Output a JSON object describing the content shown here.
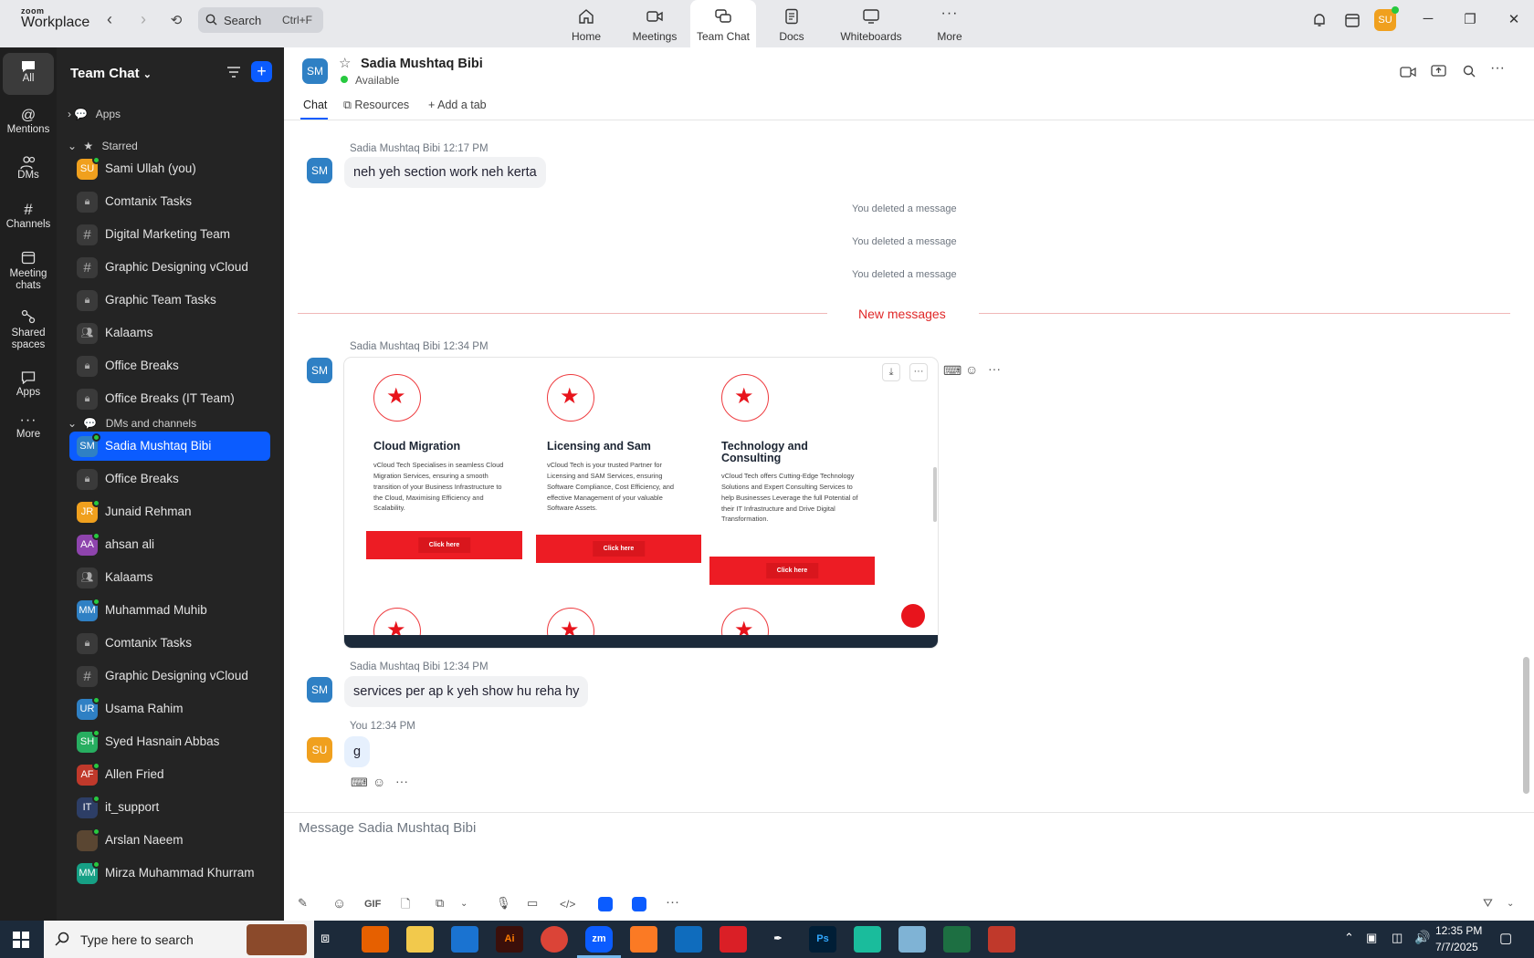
{
  "app": {
    "brand_top": "zoom",
    "brand_bottom": "Workplace"
  },
  "search": {
    "placeholder": "Search",
    "shortcut": "Ctrl+F"
  },
  "topnav": [
    {
      "label": "Home"
    },
    {
      "label": "Meetings"
    },
    {
      "label": "Team Chat"
    },
    {
      "label": "Docs"
    },
    {
      "label": "Whiteboards"
    },
    {
      "label": "More"
    }
  ],
  "user_avatar": "SU",
  "rail": [
    {
      "label": "All"
    },
    {
      "label": "Mentions"
    },
    {
      "label": "DMs"
    },
    {
      "label": "Channels"
    },
    {
      "label": "Meeting chats"
    },
    {
      "label": "Shared spaces"
    },
    {
      "label": "Apps"
    },
    {
      "label": "More"
    }
  ],
  "sidebar": {
    "title": "Team Chat",
    "apps_label": "Apps",
    "starred_label": "Starred",
    "starred": [
      {
        "label": "Sami Ullah (you)",
        "initials": "SU",
        "color": "#f0a01e"
      },
      {
        "label": "Comtanix Tasks",
        "kind": "lock"
      },
      {
        "label": "Digital Marketing Team",
        "kind": "hash"
      },
      {
        "label": "Graphic Designing vCloud",
        "kind": "hash"
      },
      {
        "label": "Graphic Team Tasks",
        "kind": "lock"
      },
      {
        "label": "Kalaams",
        "kind": "group"
      },
      {
        "label": "Office Breaks",
        "kind": "lock"
      },
      {
        "label": "Office Breaks (IT Team)",
        "kind": "lock"
      }
    ],
    "dms_label": "DMs and channels",
    "dms": [
      {
        "label": "Sadia Mushtaq Bibi",
        "initials": "SM",
        "color": "#2f80c4"
      },
      {
        "label": "Office Breaks",
        "kind": "lock"
      },
      {
        "label": "Junaid Rehman",
        "initials": "JR",
        "color": "#f0a01e"
      },
      {
        "label": "ahsan ali",
        "initials": "AA",
        "color": "#8e44ad"
      },
      {
        "label": "Kalaams",
        "kind": "group"
      },
      {
        "label": "Muhammad Muhib",
        "initials": "MM",
        "color": "#2f80c4"
      },
      {
        "label": "Comtanix Tasks",
        "kind": "lock"
      },
      {
        "label": "Graphic Designing vCloud",
        "kind": "hash"
      },
      {
        "label": "Usama Rahim",
        "initials": "UR",
        "color": "#2f80c4"
      },
      {
        "label": "Syed Hasnain Abbas",
        "initials": "SH",
        "color": "#27ae60"
      },
      {
        "label": "Allen Fried",
        "initials": "AF",
        "color": "#c0392b"
      },
      {
        "label": "it_support",
        "initials": "IT",
        "color": "#2d3e66"
      },
      {
        "label": "Arslan Naeem",
        "initials": "",
        "color": "#5a4632"
      },
      {
        "label": "Mirza Muhammad Khurram",
        "initials": "MM",
        "color": "#16a085"
      }
    ]
  },
  "chat": {
    "contact_name": "Sadia Mushtaq Bibi",
    "contact_initials": "SM",
    "status": "Available",
    "tabs": [
      "Chat",
      "Resources",
      "Add a tab"
    ],
    "messages": [
      {
        "sender": "Sadia Mushtaq Bibi",
        "time": "12:17 PM",
        "text": "neh yeh section work neh kerta"
      },
      {
        "system": "You deleted a message"
      },
      {
        "system": "You deleted a message"
      },
      {
        "system": "You deleted a message"
      },
      {
        "divider": "New messages"
      },
      {
        "sender": "Sadia Mushtaq Bibi",
        "time": "12:34 PM"
      },
      {
        "sender": "Sadia Mushtaq Bibi",
        "time": "12:34 PM",
        "text": "services per ap k yeh show hu reha hy"
      },
      {
        "sender": "You",
        "time": "12:34 PM",
        "text": "g"
      }
    ],
    "attachment": {
      "cards": [
        {
          "title": "Cloud Migration",
          "body": "vCloud Tech Specialises in seamless Cloud Migration Services, ensuring a smooth transition of your Business Infrastructure to the Cloud, Maximising Efficiency and Scalability.",
          "button": "Click here"
        },
        {
          "title": "Licensing and Sam",
          "body": "vCloud Tech is your trusted Partner for Licensing and SAM Services, ensuring Software Compliance, Cost Efficiency, and effective Management of your valuable Software Assets.",
          "button": "Click here"
        },
        {
          "title": "Technology and Consulting",
          "body": "vCloud Tech offers Cutting-Edge Technology Solutions and Expert Consulting Services to help Businesses Leverage the full Potential of their IT Infrastructure and Drive Digital Transformation.",
          "button": "Click here"
        }
      ]
    },
    "composer_placeholder": "Message Sadia Mushtaq Bibi",
    "gif_label": "GIF"
  },
  "taskbar": {
    "search_placeholder": "Type here to search",
    "time": "12:35 PM",
    "date": "7/7/2025",
    "apps": [
      "Firefox",
      "Files",
      "VS Code",
      "Ai",
      "Chrome",
      "zm",
      "XAMPP",
      "Outlook",
      "CC",
      "Pen",
      "Ps",
      "App",
      "Notepad",
      "Excel",
      "Tool"
    ]
  },
  "colors": {
    "accent": "#0b5cff",
    "new_messages": "#e02828",
    "sidebar_bg": "#242424",
    "rail_bg": "#1f1f1f"
  }
}
